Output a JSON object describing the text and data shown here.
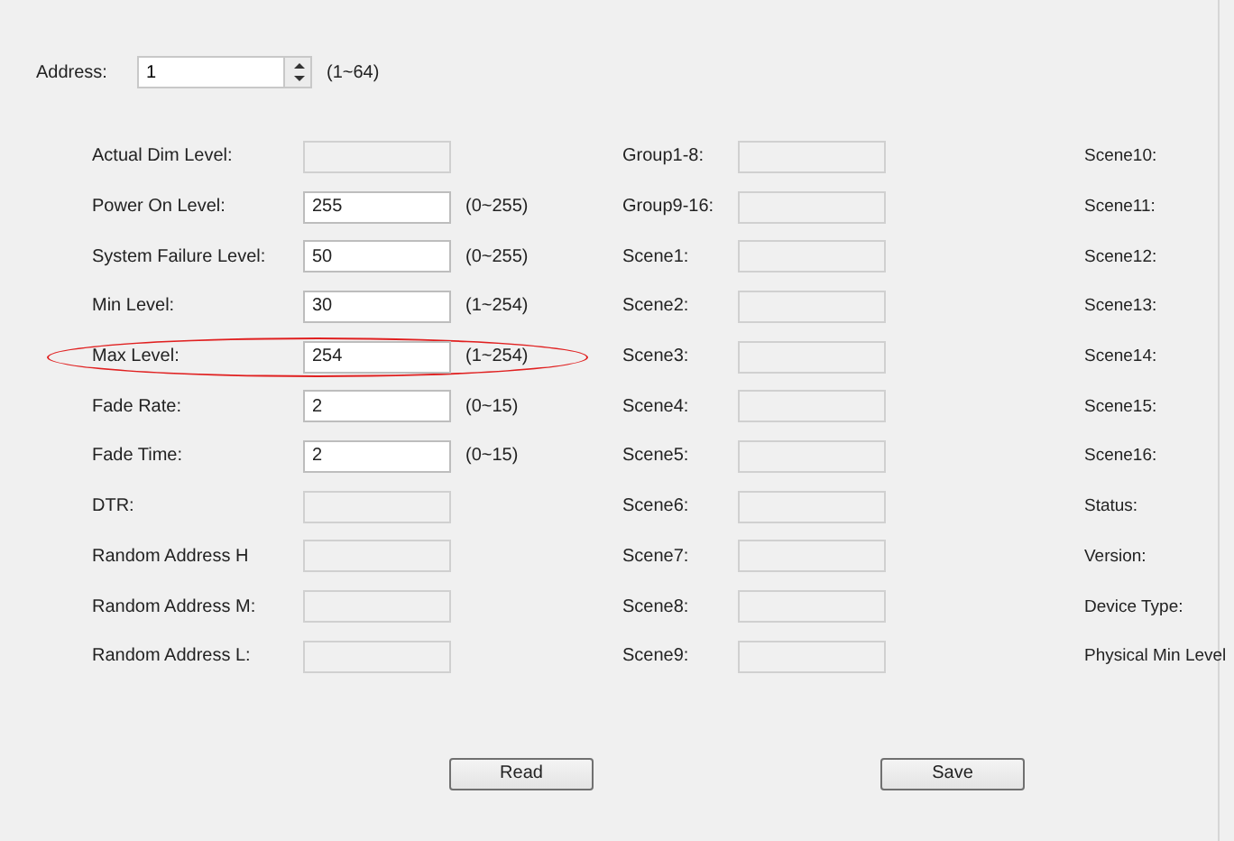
{
  "address": {
    "label": "Address:",
    "value": "1",
    "range": "(1~64)"
  },
  "left_rows": [
    {
      "label": "Actual Dim Level:",
      "disabled": true,
      "highlighted": false
    },
    {
      "label": "Power On Level:",
      "value": "255",
      "range": "(0~255)",
      "disabled": false,
      "highlighted": false
    },
    {
      "label": "System Failure Level:",
      "value": "50",
      "range": "(0~255)",
      "disabled": false,
      "highlighted": false
    },
    {
      "label": "Min Level:",
      "value": "30",
      "range": "(1~254)",
      "disabled": false,
      "highlighted": false
    },
    {
      "label": "Max Level:",
      "value": "254",
      "range": "(1~254)",
      "disabled": false,
      "highlighted": true
    },
    {
      "label": "Fade Rate:",
      "value": "2",
      "range": "(0~15)",
      "disabled": false,
      "highlighted": false
    },
    {
      "label": "Fade Time:",
      "value": "2",
      "range": "(0~15)",
      "disabled": false,
      "highlighted": false
    },
    {
      "label": "DTR:",
      "disabled": true,
      "highlighted": false
    },
    {
      "label": "Random Address H",
      "disabled": true,
      "highlighted": false
    },
    {
      "label": "Random Address M:",
      "disabled": true,
      "highlighted": false
    },
    {
      "label": "Random Address L:",
      "disabled": true,
      "highlighted": false
    }
  ],
  "middle_rows": [
    {
      "label": "Group1-8:",
      "disabled": true
    },
    {
      "label": "Group9-16:",
      "disabled": true
    },
    {
      "label": "Scene1:",
      "disabled": true
    },
    {
      "label": "Scene2:",
      "disabled": true
    },
    {
      "label": "Scene3:",
      "disabled": true
    },
    {
      "label": "Scene4:",
      "disabled": true
    },
    {
      "label": "Scene5:",
      "disabled": true
    },
    {
      "label": "Scene6:",
      "disabled": true
    },
    {
      "label": "Scene7:",
      "disabled": true
    },
    {
      "label": "Scene8:",
      "disabled": true
    },
    {
      "label": "Scene9:",
      "disabled": true
    }
  ],
  "right_rows": [
    {
      "label": "Scene10:"
    },
    {
      "label": "Scene11:"
    },
    {
      "label": "Scene12:"
    },
    {
      "label": "Scene13:"
    },
    {
      "label": "Scene14:"
    },
    {
      "label": "Scene15:"
    },
    {
      "label": "Scene16:"
    },
    {
      "label": "Status:"
    },
    {
      "label": "Version:"
    },
    {
      "label": "Device Type:"
    },
    {
      "label": "Physical Min Level"
    }
  ],
  "buttons": [
    "Read",
    "Save"
  ]
}
